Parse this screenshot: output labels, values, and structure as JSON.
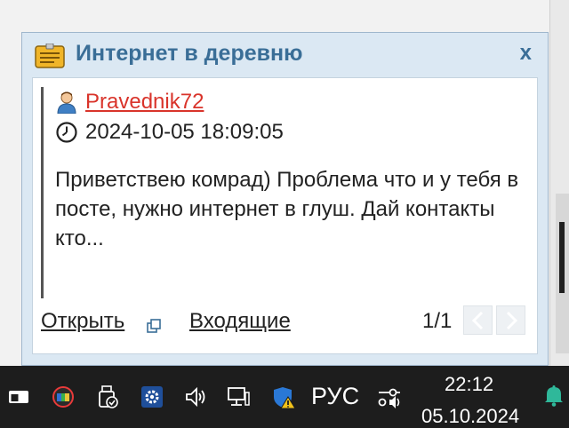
{
  "popup": {
    "title": "Интернет в деревню",
    "close_label": "x",
    "author": "Pravednik72",
    "timestamp": "2024-10-05 18:09:05",
    "message": "Приветствею комрад) Проблема что и у тебя в посте, нужно интернет в глуш. Дай контакты кто...",
    "open_label": "Открыть",
    "inbox_label": "Входящие",
    "pager": "1/1"
  },
  "taskbar": {
    "language": "РУС",
    "time": "22:12",
    "date": "05.10.2024"
  },
  "colors": {
    "title": "#3a6e97",
    "author_link": "#d9342b",
    "popup_bg": "#dbe8f3",
    "taskbar_bg": "#1d1d1d"
  },
  "icons": [
    "note-icon",
    "user-icon",
    "clock-icon",
    "external-link-icon",
    "chevron-left-icon",
    "chevron-right-icon",
    "task-view-icon",
    "gpu-monitor-icon",
    "usb-safe-remove-icon",
    "settings-gear-icon",
    "volume-icon",
    "network-icon",
    "security-warning-icon",
    "audio-mixer-icon",
    "notification-bell-icon"
  ]
}
